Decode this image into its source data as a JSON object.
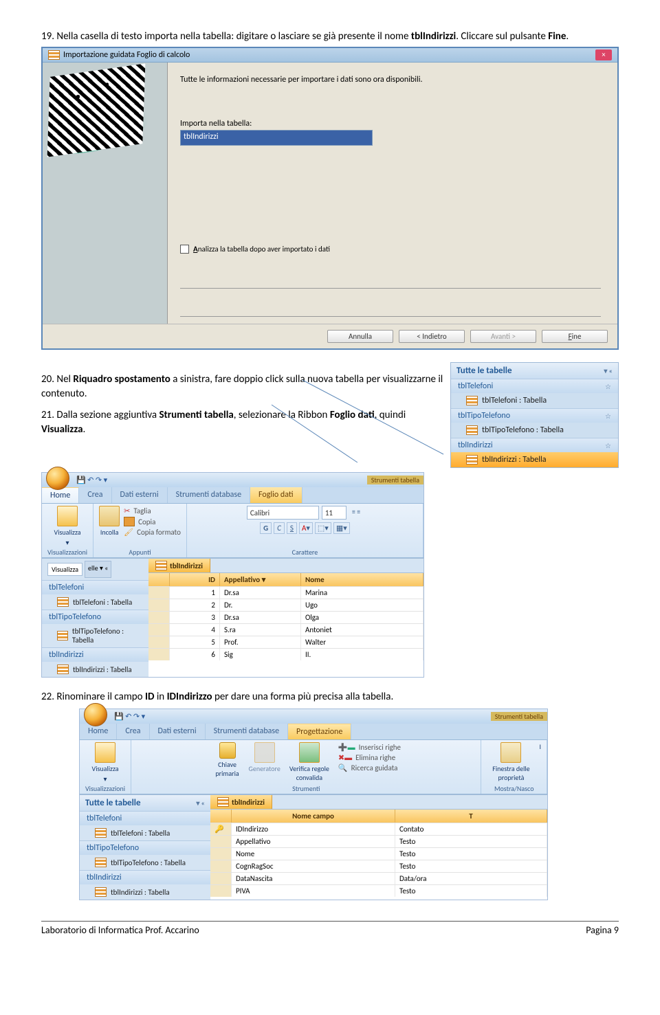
{
  "step19": {
    "pre": "19. Nella casella di testo importa nella tabella: digitare o lasciare se già presente il nome ",
    "bold1": "tblIndirizzi",
    "mid": ". Cliccare sul pulsante ",
    "bold2": "Fine",
    "end": "."
  },
  "wiz": {
    "title": "Importazione guidata Foglio di calcolo",
    "info": "Tutte le informazioni necessarie per importare i dati sono ora disponibili.",
    "label_import": "Importa nella tabella:",
    "input_value": "tblIndirizzi",
    "chk_label": "Analizza la tabella dopo aver importato i dati",
    "btn_cancel": "Annulla",
    "btn_back": "< Indietro",
    "btn_next": "Avanti >",
    "btn_finish": "Eine"
  },
  "step20": {
    "pre": "20. Nel ",
    "bold1": "Riquadro spostamento",
    "mid": " a sinistra, fare doppio click sulla nuova tabella per visualizzarne il contenuto."
  },
  "step21": {
    "pre": "21. Dalla sezione aggiuntiva ",
    "bold1": "Strumenti tabella",
    "mid": ", selezionare la Ribbon ",
    "bold2": "Foglio dati",
    "mid2": ", quindi ",
    "bold3": "Visualizza",
    "end": "."
  },
  "nav": {
    "head": "Tutte le tabelle",
    "g1": "tblTelefoni",
    "i1": "tblTelefoni : Tabella",
    "g2": "tblTipoTelefono",
    "i2": "tblTipoTelefono : Tabella",
    "g3": "tblIndirizzi",
    "i3": "tblIndirizzi : Tabella"
  },
  "rib1": {
    "ctx": "Strumenti tabella",
    "tabs": {
      "home": "Home",
      "crea": "Crea",
      "dati": "Dati esterni",
      "db": "Strumenti database",
      "foglio": "Foglio dati"
    },
    "g_vis": "Visualizzazioni",
    "btn_vis": "Visualizza",
    "g_app": "Appunti",
    "btn_inc": "Incolla",
    "taglia": "Taglia",
    "copia": "Copia",
    "copiafmt": "Copia formato",
    "g_car": "Carattere",
    "font": "Calibri",
    "size": "11",
    "popup": "Visualizza",
    "tabname": "tblIndirizzi",
    "cols": {
      "id": "ID",
      "app": "Appellativo",
      "nome": "Nome"
    },
    "rows": [
      {
        "id": "1",
        "app": "Dr.sa",
        "nome": "Marina"
      },
      {
        "id": "2",
        "app": "Dr.",
        "nome": "Ugo"
      },
      {
        "id": "3",
        "app": "Dr.sa",
        "nome": "Olga"
      },
      {
        "id": "4",
        "app": "S.ra",
        "nome": "Antoniet"
      },
      {
        "id": "5",
        "app": "Prof.",
        "nome": "Walter"
      },
      {
        "id": "6",
        "app": "Sig",
        "nome": "II."
      }
    ]
  },
  "step22": {
    "pre": "22. Rinominare il campo ",
    "bold1": "ID",
    "mid": " in ",
    "bold2": "IDIndirizzo",
    "end": " per dare una forma più precisa alla tabella."
  },
  "rib2": {
    "ctx": "Strumenti tabella",
    "tabs": {
      "home": "Home",
      "crea": "Crea",
      "dati": "Dati esterni",
      "db": "Strumenti database",
      "prog": "Progettazione"
    },
    "g_vis": "Visualizzazioni",
    "btn_vis": "Visualizza",
    "g_str": "Strumenti",
    "btn_key": "Chiave primaria",
    "btn_gen": "Generatore",
    "btn_ver": "Verifica regole convalida",
    "row_ins": "Inserisci righe",
    "row_del": "Elimina righe",
    "row_ric": "Ricerca guidata",
    "g_mostra": "Mostra/Nasco",
    "btn_fin": "Finestra delle proprietà",
    "btn_i": "I",
    "tabname": "tblIndirizzi",
    "cols": {
      "name": "Nome campo",
      "type": "T"
    },
    "rows": [
      {
        "n": "IDIndirizzo",
        "t": "Contato"
      },
      {
        "n": "Appellativo",
        "t": "Testo"
      },
      {
        "n": "Nome",
        "t": "Testo"
      },
      {
        "n": "CognRagSoc",
        "t": "Testo"
      },
      {
        "n": "DataNascita",
        "t": "Data/ora"
      },
      {
        "n": "PIVA",
        "t": "Testo"
      }
    ]
  },
  "footer": {
    "left": "Laboratorio di Informatica Prof. Accarino",
    "right": "Pagina 9"
  }
}
